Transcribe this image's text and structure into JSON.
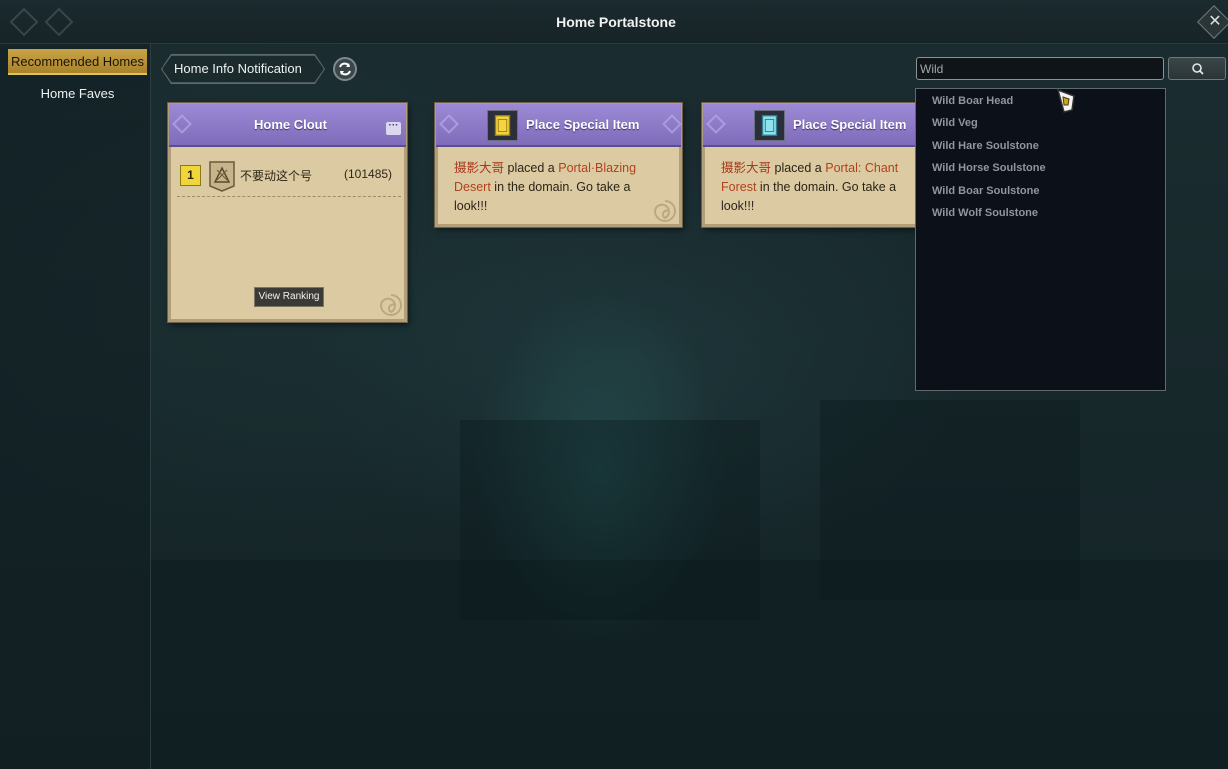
{
  "window": {
    "title": "Home Portalstone"
  },
  "sidebar": {
    "items": [
      {
        "label": "Recommended Homes",
        "active": true
      },
      {
        "label": "Home Faves",
        "active": false
      }
    ]
  },
  "breadcrumb": {
    "label": "Home Info Notification"
  },
  "search": {
    "value": "Wild",
    "suggestions": [
      "Wild Boar Head",
      "Wild Veg",
      "Wild Hare Soulstone",
      "Wild Horse Soulstone",
      "Wild Boar Soulstone",
      "Wild Wolf Soulstone"
    ]
  },
  "cards": {
    "clout": {
      "title": "Home Clout",
      "rank": "1",
      "player": "不要动这个号",
      "score": "(101485)",
      "view_ranking": "View Ranking"
    },
    "special1": {
      "title": "Place Special Item",
      "actor": "摄影大哥",
      "verb": " placed a ",
      "item": "Portal·Blazing Desert",
      "rest": " in the domain. Go take a look!!!"
    },
    "special2": {
      "title": "Place Special Item",
      "actor": "摄影大哥",
      "verb": " placed a ",
      "item": "Portal: Chant Forest",
      "rest": " in the domain. Go take a look!!!"
    }
  },
  "colors": {
    "accent_gold": "#c9a347",
    "card_header_purple": "#8f7cc8",
    "card_body": "#dccba2",
    "highlight_text": "#a8361c"
  },
  "icons": [
    "close-icon",
    "refresh-icon",
    "search-icon",
    "more-options-icon",
    "portal-scroll-icon",
    "rank-emblem-icon",
    "cursor-pointer-icon"
  ]
}
